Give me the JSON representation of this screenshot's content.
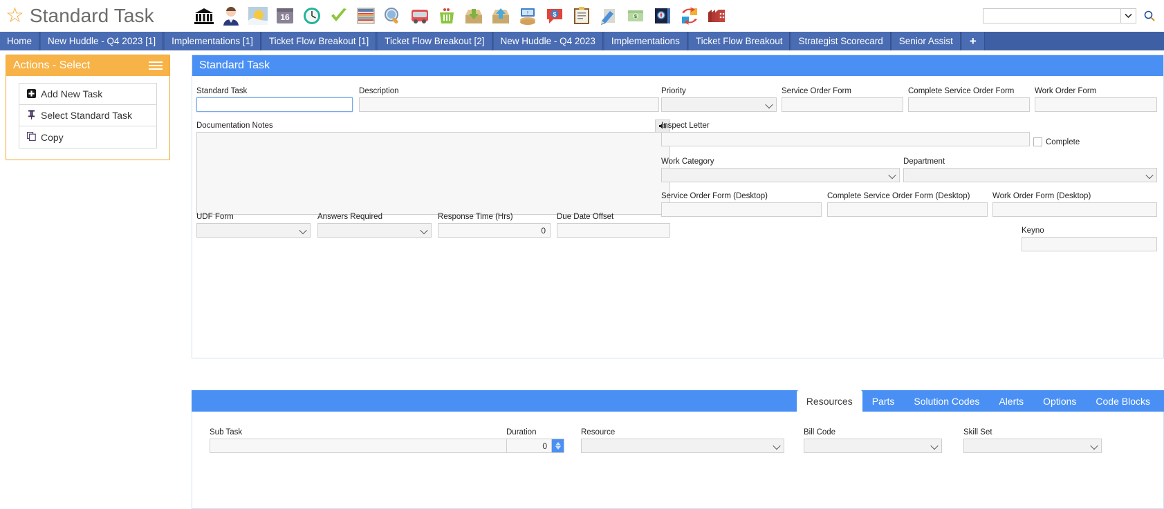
{
  "header": {
    "star_icon": "star-icon",
    "title": "Standard Task",
    "toolbar_icons": [
      {
        "name": "bank-icon",
        "glyph": "🏛"
      },
      {
        "name": "person-icon",
        "glyph": "👤"
      },
      {
        "name": "weather-icon",
        "glyph": "🌤"
      },
      {
        "name": "calendar-16-icon",
        "glyph": "16"
      },
      {
        "name": "clock-icon",
        "glyph": "🕒"
      },
      {
        "name": "checkmark-icon",
        "glyph": "✔"
      },
      {
        "name": "spreadsheet-icon",
        "glyph": "🗒"
      },
      {
        "name": "search-globe-icon",
        "glyph": "🔍"
      },
      {
        "name": "bus-icon",
        "glyph": "🚌"
      },
      {
        "name": "trash-icon",
        "glyph": "🗑"
      },
      {
        "name": "inbox-download-icon",
        "glyph": "📥"
      },
      {
        "name": "outbox-upload-icon",
        "glyph": "📤"
      },
      {
        "name": "payment-hands-icon",
        "glyph": "💵"
      },
      {
        "name": "dollar-chat-icon",
        "glyph": "💬"
      },
      {
        "name": "clipboard-icon",
        "glyph": "📋"
      },
      {
        "name": "pencil-note-icon",
        "glyph": "📝"
      },
      {
        "name": "money-stack-icon",
        "glyph": "💵"
      },
      {
        "name": "compass-book-icon",
        "glyph": "🧭"
      },
      {
        "name": "swap-arrows-icon",
        "glyph": "🔄"
      },
      {
        "name": "factory-icon",
        "glyph": "🏭"
      }
    ],
    "search": {
      "value": "",
      "placeholder": "",
      "caret_icon": "chevron-down-icon",
      "button_icon": "search-icon"
    }
  },
  "tabs": [
    {
      "label": "Home",
      "active": false
    },
    {
      "label": "New Huddle - Q4 2023 [1]",
      "active": false
    },
    {
      "label": "Implementations [1]",
      "active": false
    },
    {
      "label": "Ticket Flow Breakout [1]",
      "active": false
    },
    {
      "label": "Ticket Flow Breakout [2]",
      "active": false
    },
    {
      "label": "New Huddle - Q4 2023",
      "active": false
    },
    {
      "label": "Implementations",
      "active": false
    },
    {
      "label": "Ticket Flow Breakout",
      "active": false
    },
    {
      "label": "Strategist Scorecard",
      "active": false
    },
    {
      "label": "Senior Assist",
      "active": false
    }
  ],
  "tab_add_label": "+",
  "actions": {
    "title": "Actions - Select",
    "menu_icon": "hamburger-icon",
    "items": [
      {
        "label": "Add New Task",
        "glyph": "✚",
        "icon_name": "add-icon"
      },
      {
        "label": "Select Standard Task",
        "glyph": "📌",
        "icon_name": "pin-icon"
      },
      {
        "label": "Copy",
        "glyph": "❐",
        "icon_name": "copy-icon"
      }
    ]
  },
  "form": {
    "title": "Standard Task",
    "standard_task": {
      "label": "Standard Task",
      "value": "",
      "placeholder": ""
    },
    "description": {
      "label": "Description",
      "value": "",
      "placeholder": ""
    },
    "priority": {
      "label": "Priority",
      "value": ""
    },
    "service_order_form": {
      "label": "Service Order Form",
      "value": ""
    },
    "complete_service_order_form": {
      "label": "Complete Service Order Form",
      "value": ""
    },
    "work_order_form": {
      "label": "Work Order Form",
      "value": ""
    },
    "documentation_notes": {
      "label": "Documentation Notes",
      "value": "",
      "speaker_icon": "speaker-icon"
    },
    "inspect_letter": {
      "label": "Inspect Letter",
      "value": ""
    },
    "complete_checkbox": {
      "label": "Complete",
      "checked": false
    },
    "work_category": {
      "label": "Work Category",
      "value": ""
    },
    "department": {
      "label": "Department",
      "value": ""
    },
    "service_order_form_desktop": {
      "label": "Service Order Form (Desktop)",
      "value": ""
    },
    "complete_service_order_form_desktop": {
      "label": "Complete Service Order Form (Desktop)",
      "value": ""
    },
    "work_order_form_desktop": {
      "label": "Work Order Form (Desktop)",
      "value": ""
    },
    "keyno": {
      "label": "Keyno",
      "value": ""
    },
    "udf_form": {
      "label": "UDF Form",
      "value": ""
    },
    "answers_required": {
      "label": "Answers Required",
      "value": ""
    },
    "response_time": {
      "label": "Response Time (Hrs)",
      "value": "0"
    },
    "due_date_offset": {
      "label": "Due Date Offset",
      "value": ""
    }
  },
  "bottom": {
    "tabs": [
      {
        "label": "Resources",
        "active": true
      },
      {
        "label": "Parts",
        "active": false
      },
      {
        "label": "Solution Codes",
        "active": false
      },
      {
        "label": "Alerts",
        "active": false
      },
      {
        "label": "Options",
        "active": false
      },
      {
        "label": "Code Blocks",
        "active": false
      }
    ],
    "sub_task": {
      "label": "Sub Task",
      "value": ""
    },
    "duration": {
      "label": "Duration",
      "value": "0"
    },
    "resource": {
      "label": "Resource",
      "value": ""
    },
    "bill_code": {
      "label": "Bill Code",
      "value": ""
    },
    "skill_set": {
      "label": "Skill Set",
      "value": ""
    }
  },
  "colors": {
    "accent_blue": "#4a90f4",
    "tab_blue": "#4a6cb3",
    "actions_orange": "#f7b348",
    "star_gold": "#f4a83a"
  }
}
